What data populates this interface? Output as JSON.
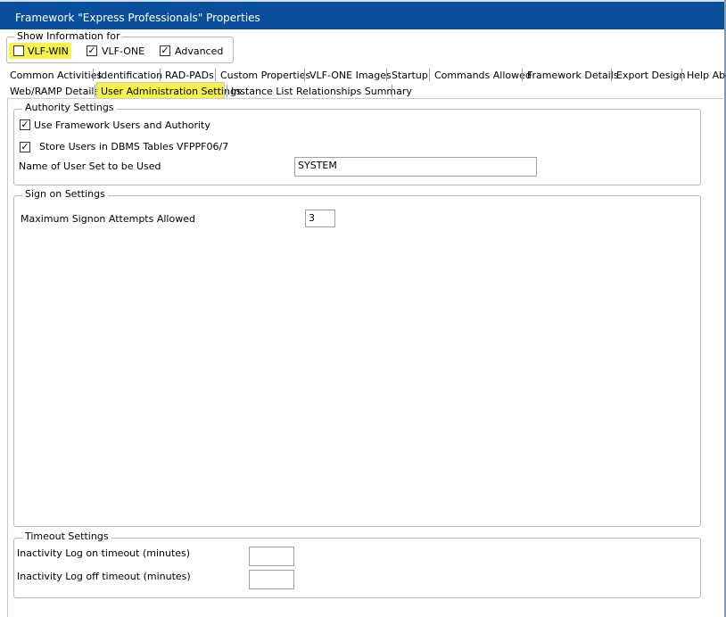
{
  "window": {
    "title": "Framework \"Express Professionals\" Properties"
  },
  "show_info": {
    "legend": "Show Information for",
    "options": [
      {
        "label": "VLF-WIN",
        "checked": false
      },
      {
        "label": "VLF-ONE",
        "checked": true
      },
      {
        "label": "Advanced",
        "checked": true
      }
    ]
  },
  "tabs": {
    "row1": [
      "Common Activities",
      "Identification",
      "RAD-PADs",
      "Custom Properties",
      "VLF-ONE Images",
      "Startup",
      "Commands Allowed",
      "Framework Details",
      "Export Design",
      "Help Abo"
    ],
    "row2": [
      "Web/RAMP Details",
      "User Administration Settings",
      "Instance List Relationships Summary"
    ],
    "selected": "User Administration Settings"
  },
  "authority": {
    "legend": "Authority Settings",
    "use_framework_users": {
      "label": "Use Framework Users and Authority",
      "checked": true
    },
    "store_users": {
      "label": "Store Users in DBMS Tables VFPPF06/7",
      "checked": true
    },
    "user_set_label": "Name of User Set to be Used",
    "user_set_value": "SYSTEM"
  },
  "signon": {
    "legend": "Sign on Settings",
    "max_attempts_label": "Maximum Signon Attempts Allowed",
    "max_attempts_value": "3"
  },
  "timeout": {
    "legend": "Timeout Settings",
    "logon_label": "Inactivity Log on timeout (minutes)",
    "logon_value": "",
    "logoff_label": "Inactivity Log off timeout (minutes)",
    "logoff_value": ""
  },
  "colors": {
    "titlebar": "#0a4f9c",
    "highlight": "#f6f24a"
  }
}
